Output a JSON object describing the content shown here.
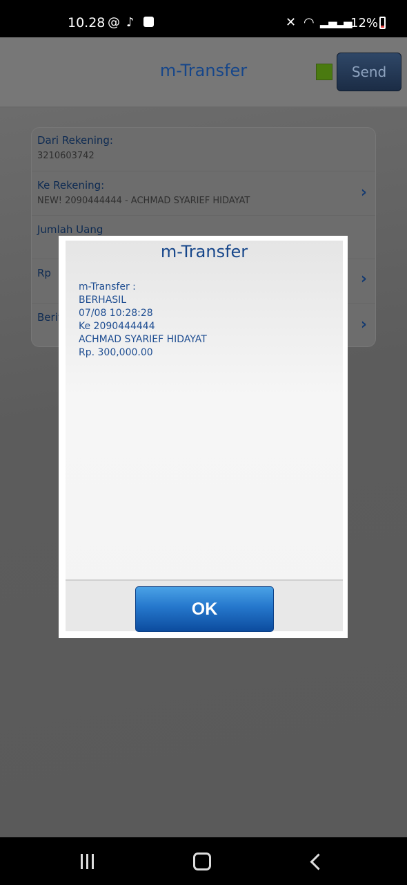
{
  "status_bar": {
    "time": "10.28",
    "battery": "12%",
    "icons": [
      "at-sign-icon",
      "tiktok-icon",
      "record-icon",
      "mute-icon",
      "wifi-icon",
      "signal-icon",
      "signal-icon",
      "battery-icon"
    ]
  },
  "app_bar": {
    "title": "m-Transfer",
    "send_label": "Send",
    "status_color": "#4a7a10"
  },
  "form": {
    "from_label": "Dari Rekening:",
    "from_value": "3210603742",
    "to_label": "Ke Rekening:",
    "to_value": "NEW! 2090444444 - ACHMAD SYARIEF HIDAYAT",
    "amount_label": "Jumlah Uang",
    "currency_label": "Rp",
    "news_label": "Berita"
  },
  "dialog": {
    "title": "m-Transfer",
    "lines": [
      "m-Transfer :",
      "BERHASIL",
      "07/08 10:28:28",
      "Ke 2090444444",
      "ACHMAD SYARIEF HIDAYAT",
      "Rp. 300,000.00"
    ],
    "ok_label": "OK"
  },
  "nav_bar": {
    "icons": [
      "recent-apps-icon",
      "home-icon",
      "back-icon"
    ]
  }
}
